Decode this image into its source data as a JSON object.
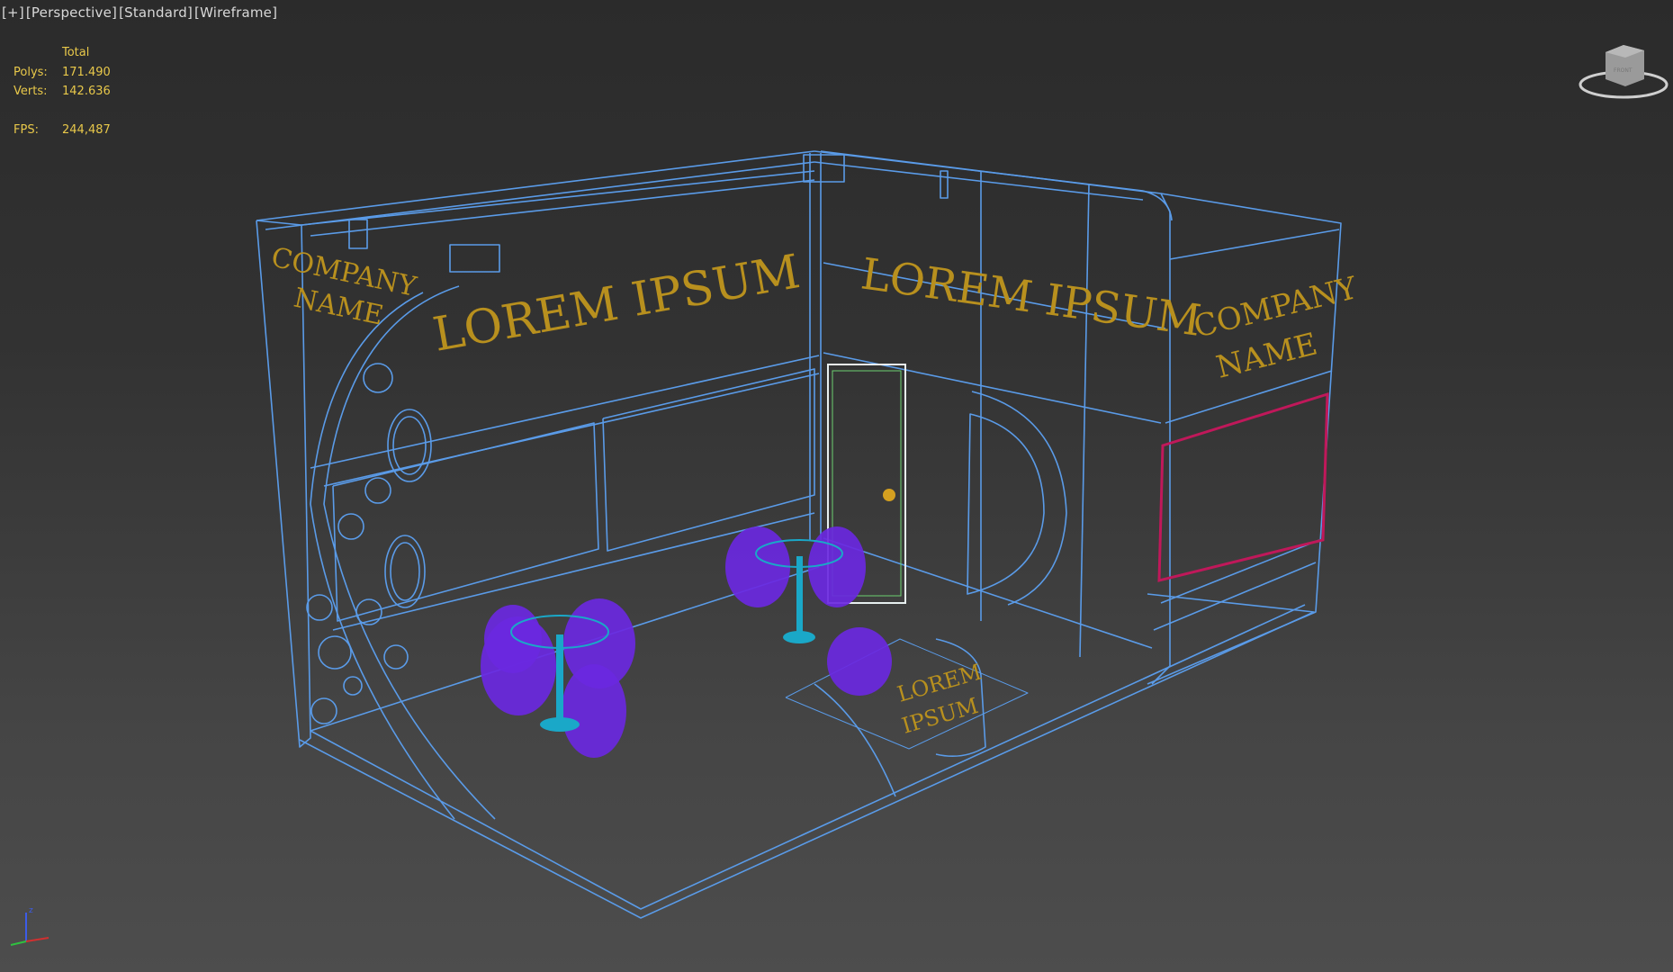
{
  "viewport": {
    "menu_label": "[+]",
    "view_label": "[Perspective]",
    "shading_label": "[Standard]",
    "mode_label": "[Wireframe]"
  },
  "stats": {
    "header": "Total",
    "polys_label": "Polys:",
    "polys_value": "171.490",
    "verts_label": "Verts:",
    "verts_value": "142.636",
    "fps_label": "FPS:",
    "fps_value": "244,487"
  },
  "scene_text": {
    "left_company_line1": "COMPANY",
    "left_company_line2": "NAME",
    "back_lorem": "LOREM IPSUM",
    "right_lorem": "LOREM IPSUM",
    "right_company_line1": "COMPANY",
    "right_company_line2": "NAME",
    "counter_lorem_line1": "LOREM",
    "counter_lorem_line2": "IPSUM"
  },
  "viewcube": {
    "label": "FRONT"
  },
  "axis_gizmo": {
    "z_label": "z"
  },
  "colors": {
    "wire": "#5a9be8",
    "text_gold": "#b8901e",
    "furniture": "#6a28e0",
    "table_stand": "#1aa8c8",
    "selection": "#e8f0f0",
    "panel_magenta": "#c0185a",
    "stats": "#e8c84a"
  }
}
